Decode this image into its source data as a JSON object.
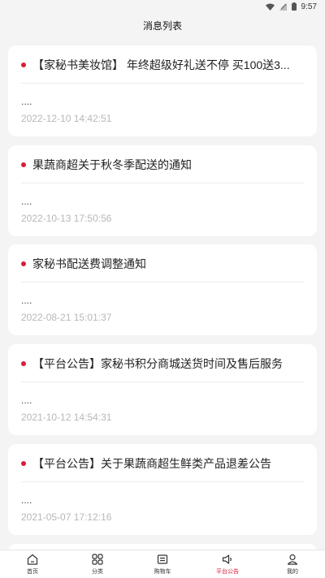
{
  "status_bar": {
    "time": "9:57"
  },
  "header": {
    "title": "消息列表"
  },
  "messages": [
    {
      "title": "【家秘书美妆馆】 年终超级好礼送不停 买100送3...",
      "summary": "....",
      "time": "2022-12-10 14:42:51"
    },
    {
      "title": "果蔬商超关于秋冬季配送的通知",
      "summary": "....",
      "time": "2022-10-13 17:50:56"
    },
    {
      "title": "家秘书配送费调整通知",
      "summary": "....",
      "time": "2022-08-21 15:01:37"
    },
    {
      "title": "【平台公告】家秘书积分商城送货时间及售后服务",
      "summary": "....",
      "time": "2021-10-12 14:54:31"
    },
    {
      "title": "【平台公告】关于果蔬商超生鲜类产品退差公告",
      "summary": "....",
      "time": "2021-05-07 17:12:16"
    }
  ],
  "tabbar": {
    "items": [
      {
        "label": "首页",
        "icon": "home-icon"
      },
      {
        "label": "分类",
        "icon": "grid-icon"
      },
      {
        "label": "购物车",
        "icon": "cart-icon"
      },
      {
        "label": "平台公告",
        "icon": "megaphone-icon",
        "active": true
      },
      {
        "label": "我的",
        "icon": "user-icon"
      }
    ]
  },
  "colors": {
    "accent": "#d81e3a",
    "background": "#f4f4f4",
    "muted_text": "#b8b8b8"
  }
}
